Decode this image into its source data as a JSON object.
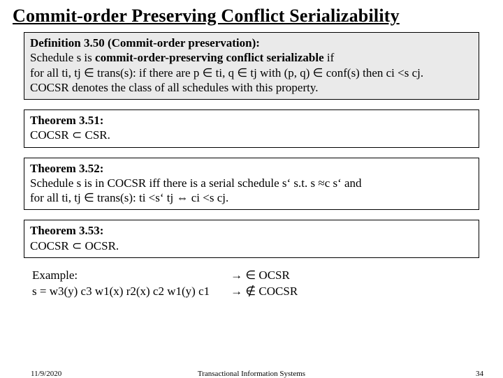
{
  "title": "Commit-order Preserving Conflict Serializability",
  "definition": {
    "heading": "Definition 3.50 (Commit-order preservation):",
    "line1_pre": "Schedule s is ",
    "line1_bold": "commit-order-preserving conflict serializable",
    "line1_post": " if",
    "line2": "for all ti, tj ∈ trans(s): if there are p ∈ ti, q ∈ tj with (p, q) ∈ conf(s) then ci <s cj.",
    "line3": "COCSR denotes the class of all schedules with this property."
  },
  "theorem51": {
    "heading": "Theorem 3.51:",
    "body": "COCSR ⊂ CSR."
  },
  "theorem52": {
    "heading": "Theorem 3.52:",
    "line1": "Schedule s is in COCSR iff there is a serial schedule s‘ s.t. s ≈c s‘ and",
    "line2": "for all ti, tj ∈ trans(s): ti <s‘ tj ⇔ ci <s cj."
  },
  "theorem53": {
    "heading": "Theorem 3.53:",
    "body": "COCSR ⊂ OCSR."
  },
  "example": {
    "label": "Example:",
    "schedule": "s = w3(y) c3 w1(x) r2(x) c2 w1(y) c1",
    "result1": "→ ∈ OCSR",
    "result2": "→ ∉ COCSR"
  },
  "footer": {
    "date": "11/9/2020",
    "center": "Transactional Information Systems",
    "page": "34"
  }
}
